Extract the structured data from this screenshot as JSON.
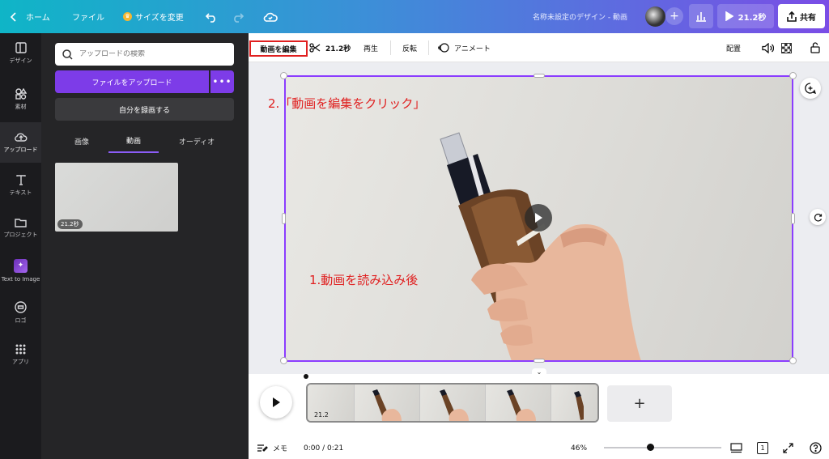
{
  "topbar": {
    "home": "ホーム",
    "file": "ファイル",
    "resize": "サイズを変更",
    "doc_title": "名称未設定のデザイン - 動画",
    "play_duration": "21.2秒",
    "share": "共有"
  },
  "rail": {
    "items": [
      {
        "label": "デザイン",
        "icon": "layout-icon"
      },
      {
        "label": "素材",
        "icon": "shapes-icon"
      },
      {
        "label": "アップロード",
        "icon": "cloud-upload-icon"
      },
      {
        "label": "テキスト",
        "icon": "text-icon"
      },
      {
        "label": "プロジェクト",
        "icon": "folder-icon"
      },
      {
        "label": "Text to Image",
        "icon": "text-to-image-icon"
      },
      {
        "label": "ロゴ",
        "icon": "logo-icon"
      },
      {
        "label": "アプリ",
        "icon": "apps-grid-icon"
      }
    ]
  },
  "panel": {
    "search_placeholder": "アップロードの検索",
    "upload_button": "ファイルをアップロード",
    "more_label": "•••",
    "record_button": "自分を録画する",
    "tabs": [
      "画像",
      "動画",
      "オーディオ"
    ],
    "active_tab": "動画",
    "thumbnail_duration": "21.2秒"
  },
  "toolbar": {
    "edit_video": "動画を編集",
    "duration": "21.2秒",
    "playback": "再生",
    "flip": "反転",
    "animate": "アニメート",
    "position": "配置"
  },
  "canvas": {
    "annotation_step2": "2.「動画を編集をクリック」",
    "annotation_step1": "1.動画を読み込み後"
  },
  "timeline": {
    "clip_duration": "21.2",
    "add": "+"
  },
  "bottombar": {
    "notes": "メモ",
    "time": "0:00 / 0:21",
    "zoom": "46%",
    "page_count": "1"
  },
  "colors": {
    "accent": "#7d3ce8",
    "annotation_red": "#e02020",
    "selection": "#8b3dff"
  }
}
